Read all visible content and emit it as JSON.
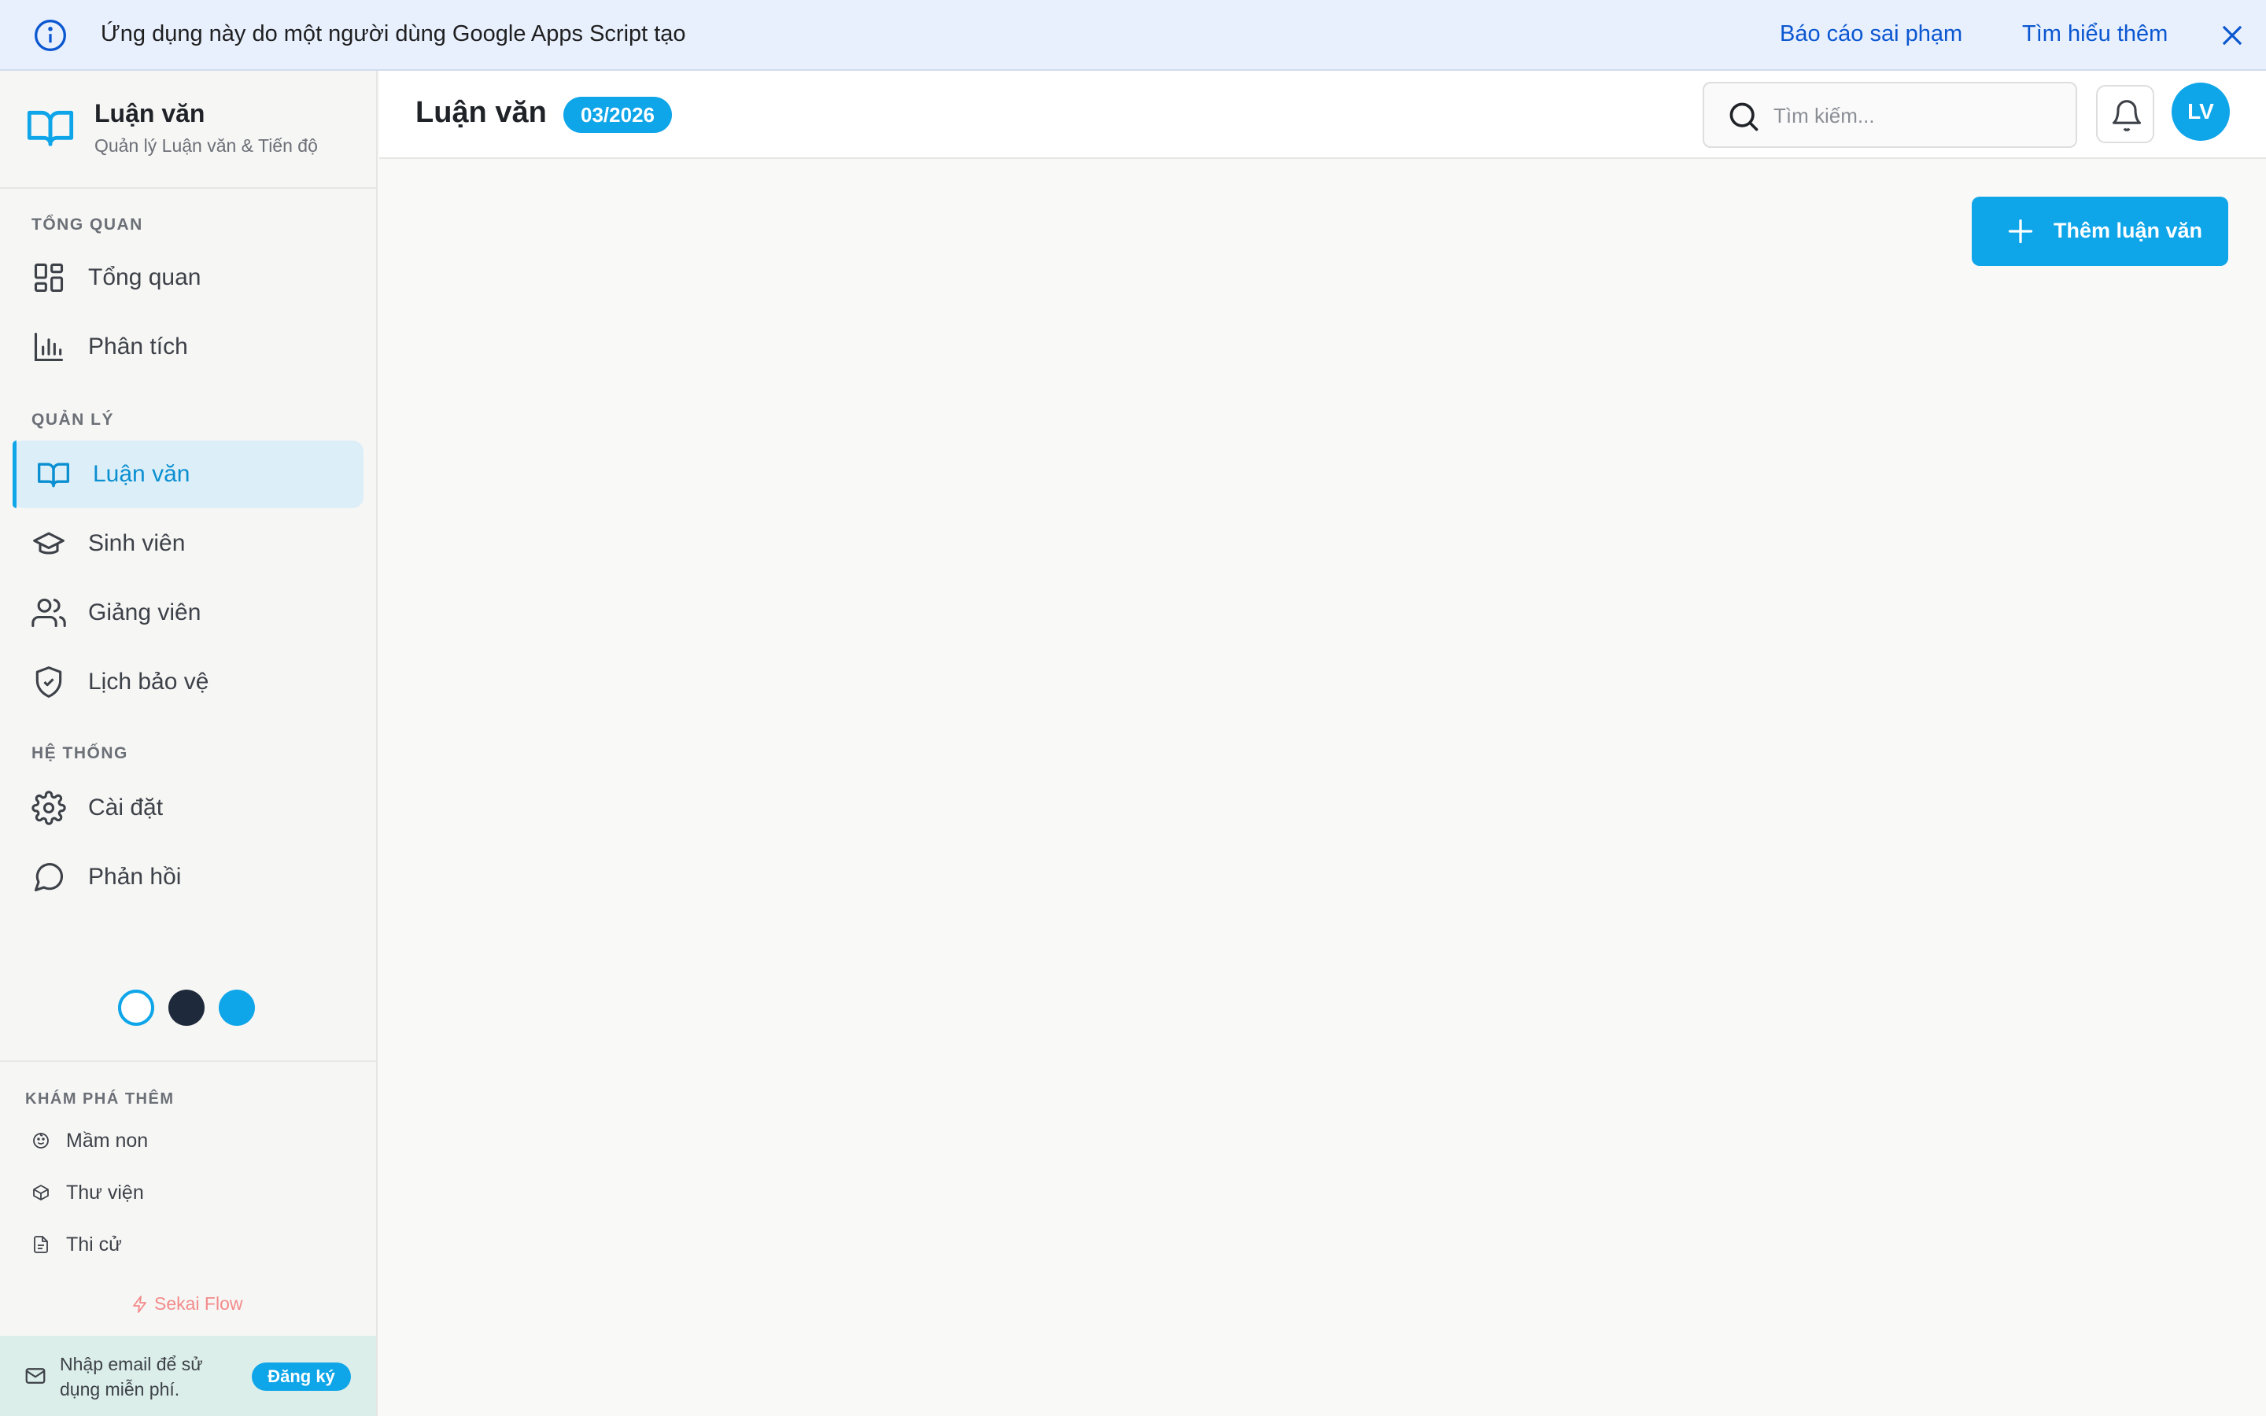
{
  "banner": {
    "message": "Ứng dụng này do một người dùng Google Apps Script tạo",
    "report_link": "Báo cáo sai phạm",
    "learn_more_link": "Tìm hiểu thêm",
    "info_icon": "info-icon",
    "close_icon": "close-icon"
  },
  "brand": {
    "title": "Luận văn",
    "subtitle": "Quản lý Luận văn & Tiến độ",
    "icon": "book-open-icon"
  },
  "sidebar": {
    "sections": [
      {
        "label": "TỔNG QUAN",
        "items": [
          {
            "label": "Tổng quan",
            "icon": "dashboard-icon"
          },
          {
            "label": "Phân tích",
            "icon": "bar-chart-icon"
          }
        ]
      },
      {
        "label": "QUẢN LÝ",
        "items": [
          {
            "label": "Luận văn",
            "icon": "book-open-icon",
            "active": true
          },
          {
            "label": "Sinh viên",
            "icon": "graduation-cap-icon"
          },
          {
            "label": "Giảng viên",
            "icon": "users-icon"
          },
          {
            "label": "Lịch bảo vệ",
            "icon": "shield-check-icon"
          }
        ]
      },
      {
        "label": "HỆ THỐNG",
        "items": [
          {
            "label": "Cài đặt",
            "icon": "gear-icon"
          },
          {
            "label": "Phản hồi",
            "icon": "chat-bubble-icon"
          }
        ]
      }
    ],
    "theme_options": [
      "light",
      "dark",
      "blue"
    ],
    "explore": {
      "label": "KHÁM PHÁ THÊM",
      "items": [
        {
          "label": "Mầm non",
          "icon": "baby-face-icon"
        },
        {
          "label": "Thư viện",
          "icon": "box-icon"
        },
        {
          "label": "Thi cử",
          "icon": "document-icon"
        }
      ]
    },
    "footer_brand": "Sekai Flow",
    "signup": {
      "text": "Nhập email để sử dụng miễn phí.",
      "button": "Đăng ký"
    }
  },
  "header": {
    "title": "Luận văn",
    "badge": "03/2026",
    "search_placeholder": "Tìm kiếm...",
    "search_value": "",
    "avatar_initials": "LV"
  },
  "main": {
    "add_button": "Thêm luận văn"
  },
  "colors": {
    "accent": "#0ea5e9",
    "banner_bg": "#e8f0fe",
    "link": "#0b57d0",
    "active_bg": "#dceef7",
    "signup_bg": "#dbeee9",
    "sekai": "#f38b8b"
  }
}
